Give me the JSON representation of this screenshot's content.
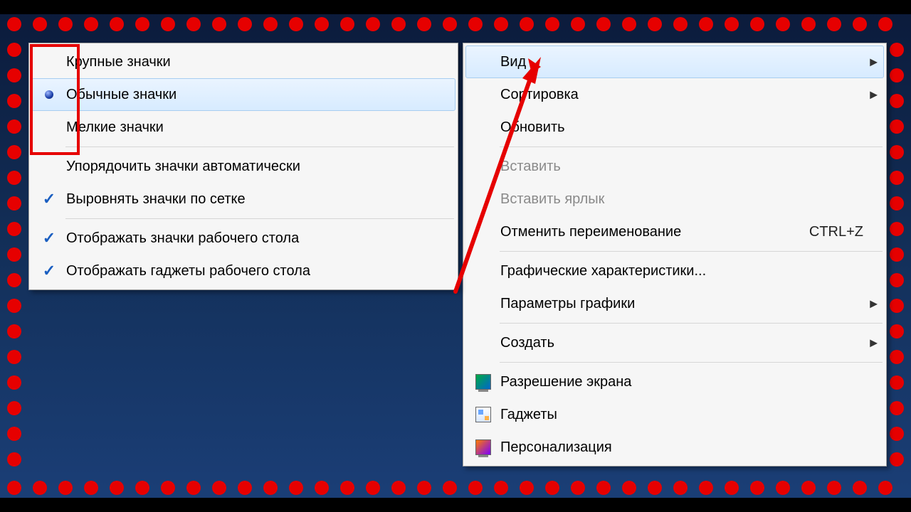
{
  "contextMenu": {
    "items": [
      {
        "label": "Вид",
        "submenu": true,
        "highlight": true
      },
      {
        "label": "Сортировка",
        "submenu": true
      },
      {
        "label": "Обновить"
      },
      {
        "sep": true
      },
      {
        "label": "Вставить",
        "disabled": true
      },
      {
        "label": "Вставить ярлык",
        "disabled": true
      },
      {
        "label": "Отменить переименование",
        "accel": "CTRL+Z"
      },
      {
        "sep": true
      },
      {
        "label": "Графические характеристики..."
      },
      {
        "label": "Параметры графики",
        "submenu": true
      },
      {
        "sep": true
      },
      {
        "label": "Создать",
        "submenu": true
      },
      {
        "sep": true
      },
      {
        "label": "Разрешение экрана",
        "icon": "monitor"
      },
      {
        "label": "Гаджеты",
        "icon": "gadget"
      },
      {
        "label": "Персонализация",
        "icon": "person"
      }
    ]
  },
  "viewSubmenu": {
    "items": [
      {
        "label": "Крупные значки"
      },
      {
        "label": "Обычные значки",
        "radio": true,
        "highlight": true
      },
      {
        "label": "Мелкие значки"
      },
      {
        "sep": true
      },
      {
        "label": "Упорядочить значки автоматически"
      },
      {
        "label": "Выровнять значки по сетке",
        "check": true
      },
      {
        "sep": true
      },
      {
        "label": "Отображать значки рабочего стола",
        "check": true
      },
      {
        "label": "Отображать гаджеты  рабочего стола",
        "check": true
      }
    ]
  }
}
